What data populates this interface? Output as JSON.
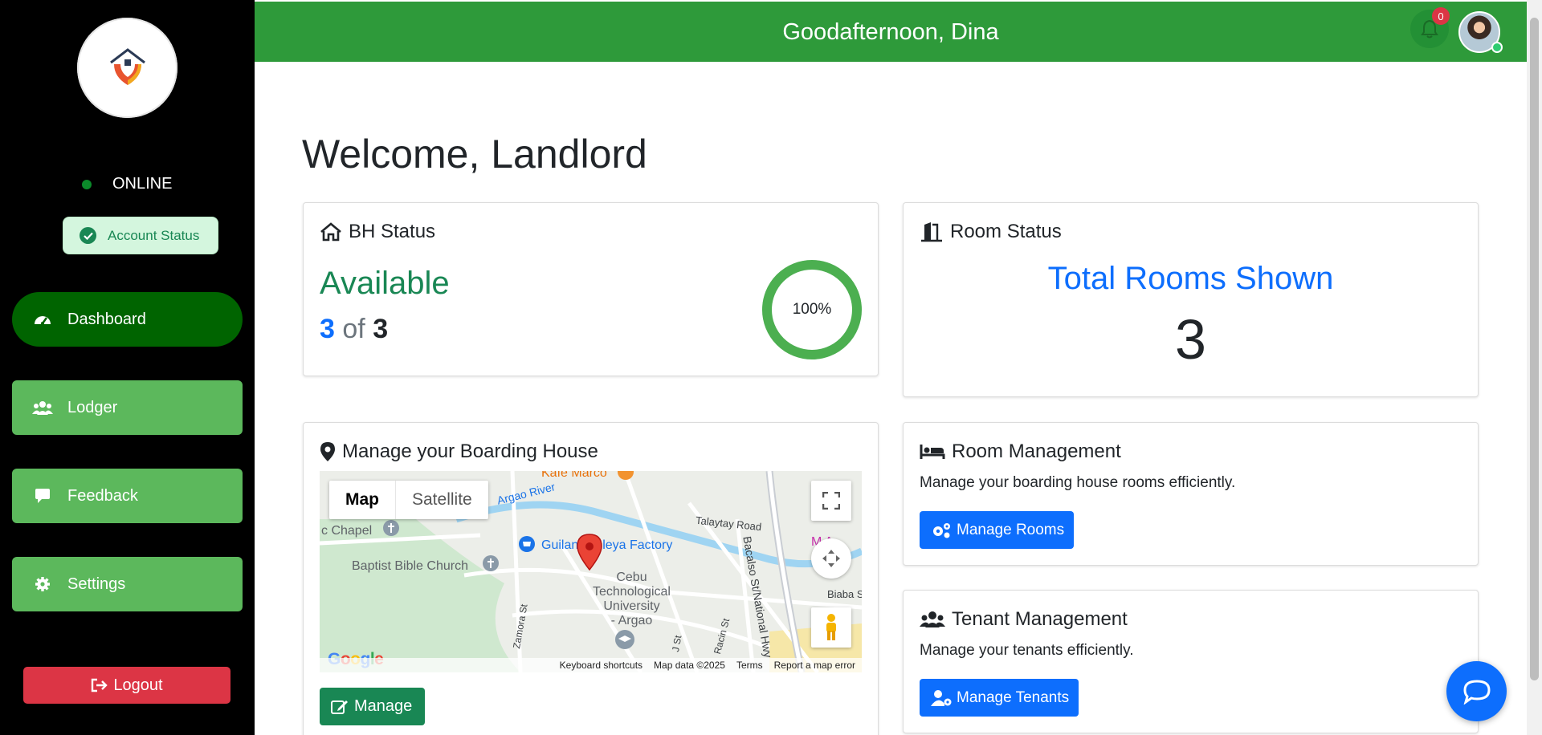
{
  "sidebar": {
    "status_text": "ONLINE",
    "account_status_label": "Account Status",
    "nav": [
      {
        "label": "Dashboard",
        "icon": "tachometer-icon",
        "active": true
      },
      {
        "label": "Lodger",
        "icon": "users-icon"
      },
      {
        "label": "Feedback",
        "icon": "comment-icon"
      },
      {
        "label": "Settings",
        "icon": "gear-icon"
      }
    ],
    "logout_label": "Logout"
  },
  "header": {
    "greeting": "Goodafternoon, Dina",
    "notification_count": "0"
  },
  "main": {
    "welcome": "Welcome, Landlord",
    "bh_status": {
      "title": "BH Status",
      "state": "Available",
      "available": "3",
      "of_word": "of",
      "total": "3",
      "percent_label": "100%",
      "percent_value": 100
    },
    "room_status": {
      "title": "Room Status",
      "shown_label": "Total Rooms Shown",
      "count": "3"
    },
    "boarding_house": {
      "title": "Manage your Boarding House",
      "manage_label": "Manage",
      "map": {
        "tab_map": "Map",
        "tab_satellite": "Satellite",
        "labels": {
          "kafe": "Kafe Marco",
          "river": "Argao River",
          "talaytay": "Talaytay Road",
          "bacalso": "Bacalso St/National Hwy",
          "chapel": "c Chapel",
          "church": "Baptist Bible Church",
          "factory": "Guilan Tableya Factory",
          "university": "Cebu\nTechnological\nUniversity\n- Argao",
          "zamora": "Zamora St",
          "biaba": "Biaba S",
          "jst": "J St",
          "racin": "Racin St",
          "manga": "M  A"
        },
        "footer": [
          "Keyboard shortcuts",
          "Map data ©2025",
          "Terms",
          "Report a map error"
        ],
        "logo": "Google"
      }
    },
    "room_management": {
      "title": "Room Management",
      "desc": "Manage your boarding house rooms efficiently.",
      "button": "Manage Rooms"
    },
    "tenant_management": {
      "title": "Tenant Management",
      "desc": "Manage your tenants efficiently.",
      "button": "Manage Tenants"
    }
  },
  "colors": {
    "header_green": "#2e9a3a",
    "nav_green": "#5cb85c",
    "nav_active": "#006400",
    "primary_blue": "#0d6efd",
    "success_green": "#198754",
    "danger_red": "#dc3545"
  }
}
